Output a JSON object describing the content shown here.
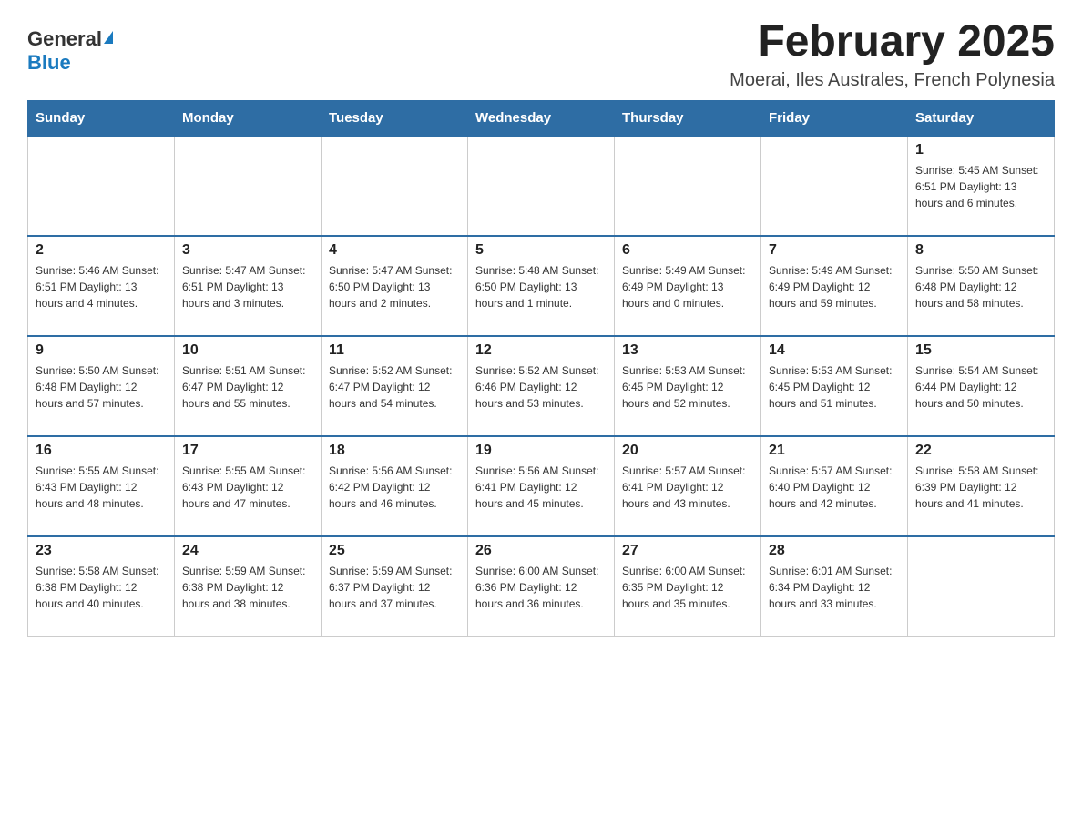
{
  "logo": {
    "general": "General",
    "blue": "Blue"
  },
  "title": "February 2025",
  "location": "Moerai, Iles Australes, French Polynesia",
  "days_of_week": [
    "Sunday",
    "Monday",
    "Tuesday",
    "Wednesday",
    "Thursday",
    "Friday",
    "Saturday"
  ],
  "weeks": [
    [
      {
        "day": "",
        "info": ""
      },
      {
        "day": "",
        "info": ""
      },
      {
        "day": "",
        "info": ""
      },
      {
        "day": "",
        "info": ""
      },
      {
        "day": "",
        "info": ""
      },
      {
        "day": "",
        "info": ""
      },
      {
        "day": "1",
        "info": "Sunrise: 5:45 AM\nSunset: 6:51 PM\nDaylight: 13 hours and 6 minutes."
      }
    ],
    [
      {
        "day": "2",
        "info": "Sunrise: 5:46 AM\nSunset: 6:51 PM\nDaylight: 13 hours and 4 minutes."
      },
      {
        "day": "3",
        "info": "Sunrise: 5:47 AM\nSunset: 6:51 PM\nDaylight: 13 hours and 3 minutes."
      },
      {
        "day": "4",
        "info": "Sunrise: 5:47 AM\nSunset: 6:50 PM\nDaylight: 13 hours and 2 minutes."
      },
      {
        "day": "5",
        "info": "Sunrise: 5:48 AM\nSunset: 6:50 PM\nDaylight: 13 hours and 1 minute."
      },
      {
        "day": "6",
        "info": "Sunrise: 5:49 AM\nSunset: 6:49 PM\nDaylight: 13 hours and 0 minutes."
      },
      {
        "day": "7",
        "info": "Sunrise: 5:49 AM\nSunset: 6:49 PM\nDaylight: 12 hours and 59 minutes."
      },
      {
        "day": "8",
        "info": "Sunrise: 5:50 AM\nSunset: 6:48 PM\nDaylight: 12 hours and 58 minutes."
      }
    ],
    [
      {
        "day": "9",
        "info": "Sunrise: 5:50 AM\nSunset: 6:48 PM\nDaylight: 12 hours and 57 minutes."
      },
      {
        "day": "10",
        "info": "Sunrise: 5:51 AM\nSunset: 6:47 PM\nDaylight: 12 hours and 55 minutes."
      },
      {
        "day": "11",
        "info": "Sunrise: 5:52 AM\nSunset: 6:47 PM\nDaylight: 12 hours and 54 minutes."
      },
      {
        "day": "12",
        "info": "Sunrise: 5:52 AM\nSunset: 6:46 PM\nDaylight: 12 hours and 53 minutes."
      },
      {
        "day": "13",
        "info": "Sunrise: 5:53 AM\nSunset: 6:45 PM\nDaylight: 12 hours and 52 minutes."
      },
      {
        "day": "14",
        "info": "Sunrise: 5:53 AM\nSunset: 6:45 PM\nDaylight: 12 hours and 51 minutes."
      },
      {
        "day": "15",
        "info": "Sunrise: 5:54 AM\nSunset: 6:44 PM\nDaylight: 12 hours and 50 minutes."
      }
    ],
    [
      {
        "day": "16",
        "info": "Sunrise: 5:55 AM\nSunset: 6:43 PM\nDaylight: 12 hours and 48 minutes."
      },
      {
        "day": "17",
        "info": "Sunrise: 5:55 AM\nSunset: 6:43 PM\nDaylight: 12 hours and 47 minutes."
      },
      {
        "day": "18",
        "info": "Sunrise: 5:56 AM\nSunset: 6:42 PM\nDaylight: 12 hours and 46 minutes."
      },
      {
        "day": "19",
        "info": "Sunrise: 5:56 AM\nSunset: 6:41 PM\nDaylight: 12 hours and 45 minutes."
      },
      {
        "day": "20",
        "info": "Sunrise: 5:57 AM\nSunset: 6:41 PM\nDaylight: 12 hours and 43 minutes."
      },
      {
        "day": "21",
        "info": "Sunrise: 5:57 AM\nSunset: 6:40 PM\nDaylight: 12 hours and 42 minutes."
      },
      {
        "day": "22",
        "info": "Sunrise: 5:58 AM\nSunset: 6:39 PM\nDaylight: 12 hours and 41 minutes."
      }
    ],
    [
      {
        "day": "23",
        "info": "Sunrise: 5:58 AM\nSunset: 6:38 PM\nDaylight: 12 hours and 40 minutes."
      },
      {
        "day": "24",
        "info": "Sunrise: 5:59 AM\nSunset: 6:38 PM\nDaylight: 12 hours and 38 minutes."
      },
      {
        "day": "25",
        "info": "Sunrise: 5:59 AM\nSunset: 6:37 PM\nDaylight: 12 hours and 37 minutes."
      },
      {
        "day": "26",
        "info": "Sunrise: 6:00 AM\nSunset: 6:36 PM\nDaylight: 12 hours and 36 minutes."
      },
      {
        "day": "27",
        "info": "Sunrise: 6:00 AM\nSunset: 6:35 PM\nDaylight: 12 hours and 35 minutes."
      },
      {
        "day": "28",
        "info": "Sunrise: 6:01 AM\nSunset: 6:34 PM\nDaylight: 12 hours and 33 minutes."
      },
      {
        "day": "",
        "info": ""
      }
    ]
  ]
}
